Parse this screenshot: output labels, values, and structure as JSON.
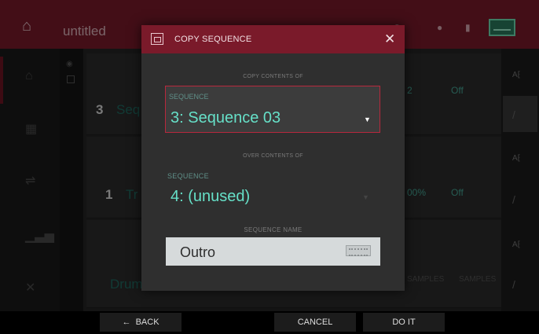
{
  "topbar": {
    "home_icon": "home-icon",
    "title": "untitled",
    "accent": "#7a1a2a"
  },
  "background": {
    "row1": {
      "number": "3",
      "text": "Seq",
      "right_value": "2",
      "right_value2": "Off"
    },
    "row2": {
      "number": "1",
      "text": "Tr",
      "right_value": "00%",
      "right_value2": "Off"
    },
    "row3": {
      "text": "Drum",
      "small1": "SAMPLES",
      "small2": "SAMPLES"
    }
  },
  "modal": {
    "title": "COPY SEQUENCE",
    "close_icon": "close-icon",
    "copy_caption": "COPY CONTENTS OF",
    "source": {
      "label": "SEQUENCE",
      "value": "3: Sequence 03"
    },
    "over_caption": "OVER CONTENTS OF",
    "target": {
      "label": "SEQUENCE",
      "value": "4: (unused)"
    },
    "name_label": "SEQUENCE NAME",
    "name_value": "Outro",
    "keyboard_icon": "keyboard-icon"
  },
  "bottombar": {
    "back_label": "BACK",
    "cancel_label": "CANCEL",
    "doit_label": "DO IT"
  },
  "colors": {
    "accent": "#7a1a2a",
    "value_teal": "#66e0c8",
    "selected_border": "#b8283d"
  }
}
